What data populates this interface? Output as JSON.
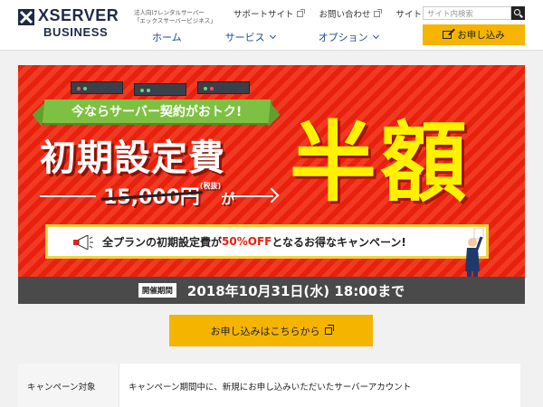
{
  "header": {
    "brand": "XSERVER",
    "brand_sub": "BUSINESS",
    "tagline": "法人向けレンタルサーバー\n「エックスサーバービジネス」",
    "util_links": [
      "サポートサイト",
      "お問い合わせ",
      "サイトマップ"
    ],
    "search_placeholder": "サイト内検索",
    "nav": [
      "ホーム",
      "サービス",
      "オプション"
    ],
    "apply_label": "お申し込み"
  },
  "banner": {
    "promo": "今ならサーバー契約がおトク!",
    "fee_title": "初期設定費",
    "old_price": "15,000円",
    "old_price_tax": "(税抜)",
    "old_price_suffix": "が",
    "headline": "半額",
    "notice_pre": "全プランの初期設定費が",
    "notice_pct": "50%OFF",
    "notice_post": "となるお得なキャンペーン!",
    "period_label": "開催期間",
    "period_date": "2018年10月31日(水) 18:00まで"
  },
  "cta": {
    "label": "お申し込みはこちらから"
  },
  "table": {
    "head": "キャンペーン対象",
    "value": "キャンペーン期間中に、新規にお申し込みいただいたサーバーアカウント"
  },
  "colors": {
    "brand_navy": "#1e2b45",
    "accent_yellow": "#f4b400",
    "banner_red": "#e8200e",
    "promo_green": "#7ec142",
    "headline_yellow": "#fff200"
  }
}
